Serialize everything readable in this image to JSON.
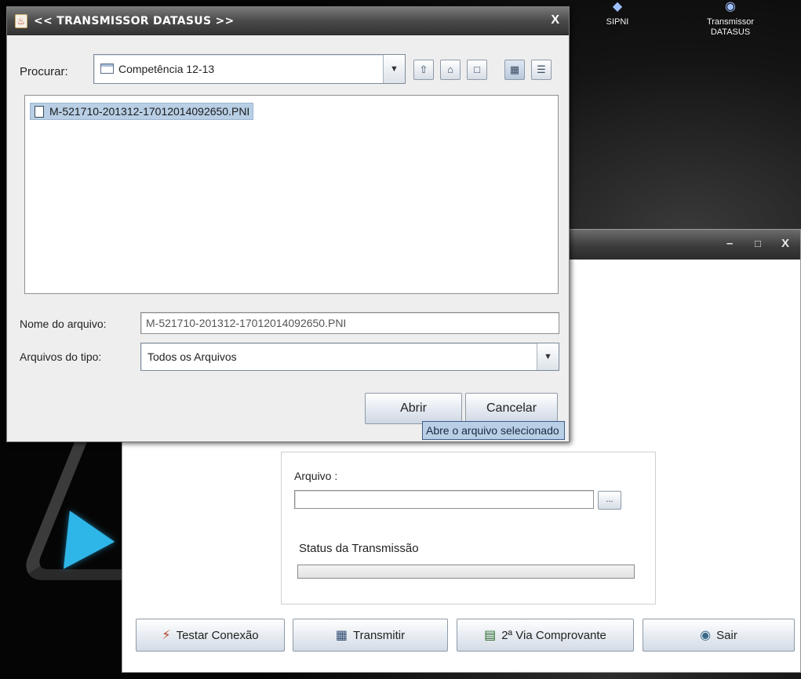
{
  "desktop": {
    "icons": [
      {
        "label": "SIPNI",
        "icon": "sipni-app-icon"
      },
      {
        "label": "Transmissor DATASUS",
        "icon": "transmissor-app-icon"
      }
    ]
  },
  "main_window": {
    "controls": {
      "minimize": "–",
      "maximize": "□",
      "close": "X"
    },
    "arquivo_label": "Arquivo :",
    "arquivo_value": "",
    "browse_label": "...",
    "status_label": "Status da Transmissão",
    "progress": 0,
    "buttons": {
      "testar": "Testar Conexão",
      "transmitir": "Transmitir",
      "comprovante": "2ª Via Comprovante",
      "sair": "Sair"
    }
  },
  "dialog": {
    "title": "<< TRANSMISSOR DATASUS >>",
    "close": "X",
    "look_in_label": "Procurar:",
    "look_in_value": "Competência 12-13",
    "toolbar": [
      "up-folder-icon",
      "home-icon",
      "new-folder-icon",
      "list-view-icon",
      "details-view-icon"
    ],
    "files": [
      "M-521710-201312-17012014092650.PNI"
    ],
    "filename_label": "Nome do arquivo:",
    "filename_value": "M-521710-201312-17012014092650.PNI",
    "filetype_label": "Arquivos do tipo:",
    "filetype_value": "Todos os Arquivos",
    "open_button": "Abrir",
    "cancel_button": "Cancelar",
    "tooltip": "Abre o arquivo selecionado"
  },
  "colors": {
    "selection": "#b8cfe5",
    "titlebar": "#3c3c3c",
    "accent_blue": "#2fb6e8"
  }
}
